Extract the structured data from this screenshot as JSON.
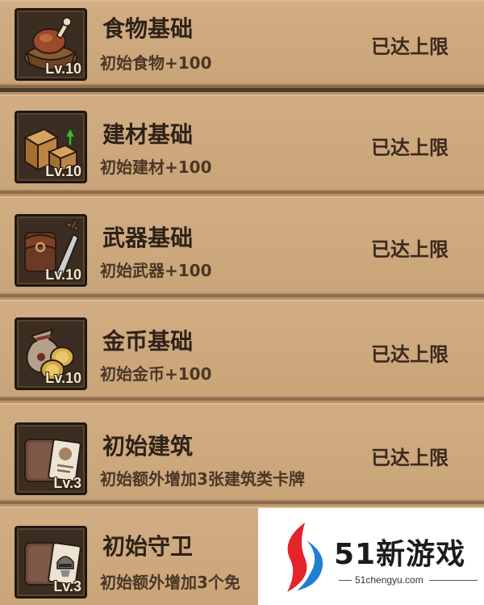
{
  "upgrades": [
    {
      "title": "食物基础",
      "desc": "初始食物+100",
      "level": "Lv.10",
      "status": "已达上限",
      "icon": "food-basket-icon"
    },
    {
      "title": "建材基础",
      "desc": "初始建材+100",
      "level": "Lv.10",
      "status": "已达上限",
      "icon": "building-material-icon"
    },
    {
      "title": "武器基础",
      "desc": "初始武器+100",
      "level": "Lv.10",
      "status": "已达上限",
      "icon": "weapon-icon"
    },
    {
      "title": "金币基础",
      "desc": "初始金币+100",
      "level": "Lv.10",
      "status": "已达上限",
      "icon": "gold-coin-bag-icon"
    },
    {
      "title": "初始建筑",
      "desc": "初始额外增加3张建筑类卡牌",
      "level": "Lv.3",
      "status": "已达上限",
      "icon": "building-card-icon"
    },
    {
      "title": "初始守卫",
      "desc": "初始额外增加3个免",
      "level": "Lv.3",
      "status": "",
      "icon": "guard-card-icon"
    }
  ],
  "watermark": {
    "brand": "51新游戏",
    "url": "51chengyu.com"
  },
  "colors": {
    "row_bg": "#d2ad83",
    "text_dark": "#2e2118",
    "icon_bg": "#3b2d22"
  }
}
